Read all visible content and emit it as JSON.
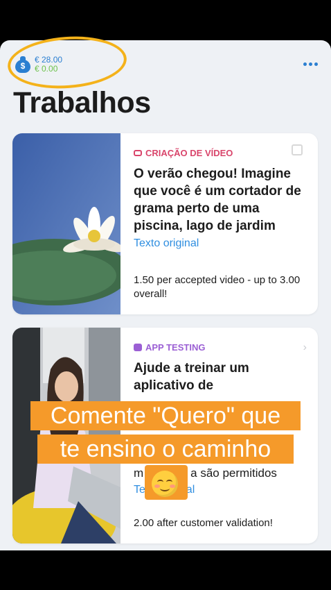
{
  "header": {
    "balance_main": "€ 28.00",
    "balance_sub": "€ 0.00",
    "wallet_icon_glyph": "$",
    "title": "Trabalhos",
    "more_icon": "ellipsis-icon"
  },
  "jobs": [
    {
      "category": "CRIAÇÃO DE VÍDEO",
      "category_color": "#d9456b",
      "title": "O verão chegou! Imagine que você é um cortador de grama perto de uma piscina, lago de jardim",
      "original_link": "Texto original",
      "payment": "1.50 per accepted video - up to 3.00 overall!"
    },
    {
      "category": "APP TESTING",
      "category_color": "#9b5fd4",
      "title": "Ajude a treinar um aplicativo de",
      "hidden_line": "m",
      "hidden_line_end": "a são permitidos",
      "original_link_prefix": "Te",
      "original_link_suffix": "nal",
      "payment": "2.00 after customer validation!"
    }
  ],
  "overlay": {
    "line1": "Comente \"Quero\" que",
    "line2": "te ensino o caminho",
    "emoji": "smiling-face-emoji"
  },
  "colors": {
    "accent": "#2b7fd1",
    "highlight_circle": "#f4b21a",
    "overlay_bg": "#f59a2a",
    "link": "#2f8ee0"
  }
}
